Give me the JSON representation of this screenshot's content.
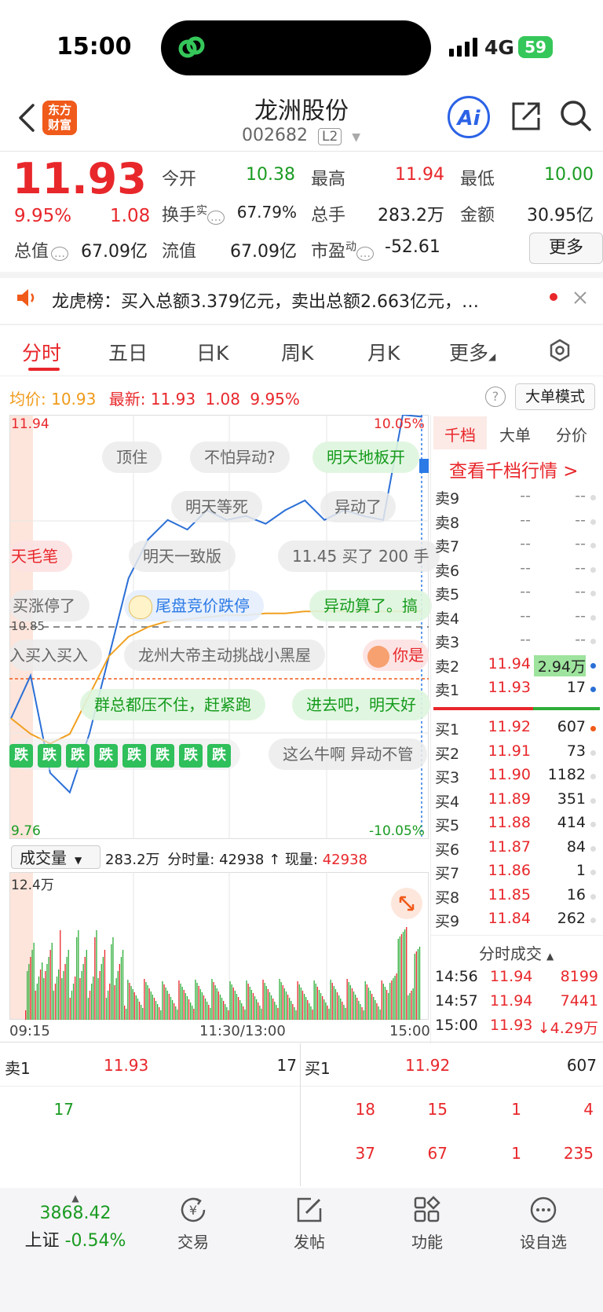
{
  "status": {
    "time": "15:00",
    "network": "4G",
    "battery": "59"
  },
  "header": {
    "logo_line1": "东方",
    "logo_line2": "财富",
    "name": "龙洲股份",
    "code": "002682",
    "level": "L2",
    "ai_label": "Ai"
  },
  "quote": {
    "price": "11.93",
    "pct": "9.95%",
    "change": "1.08",
    "open_label": "今开",
    "open": "10.38",
    "high_label": "最高",
    "high": "11.94",
    "low_label": "最低",
    "low": "10.00",
    "turnover_label": "换手",
    "turnover_sup": "实",
    "turnover": "67.79%",
    "volume_label": "总手",
    "volume": "283.2万",
    "amount_label": "金额",
    "amount": "30.95亿",
    "mcap_label": "总值",
    "mcap": "67.09亿",
    "float_label": "流值",
    "float": "67.09亿",
    "pe_label": "市盈",
    "pe_sup": "动",
    "pe": "-52.61",
    "more": "更多"
  },
  "notice": {
    "text": "龙虎榜：买入总额3.379亿元，卖出总额2.663亿元，…"
  },
  "tabs": [
    "分时",
    "五日",
    "日K",
    "周K",
    "月K",
    "更多"
  ],
  "avgbar": {
    "avg_label": "均价:",
    "avg": "10.93",
    "latest_label": "最新:",
    "latest": "11.93",
    "chg": "1.08",
    "pct": "9.95%",
    "mode": "大单模式"
  },
  "chart": {
    "y_max": "11.94",
    "y_min": "9.76",
    "pct_max": "10.05%",
    "pct_min": "-10.05%",
    "ref_price": "10.85",
    "bubbles": [
      "顶住",
      "不怕异动?",
      "明天地板开",
      "明天等死",
      "异动了",
      "天毛笔",
      "明天一致版",
      "11.45 买了 200 手",
      "买涨停了",
      "尾盘竞价跌停",
      "异动算了。搞",
      "入买入买入",
      "龙州大帝主动挑战小黑屋",
      "你是",
      "群总都压不住，赶紧跑",
      "进去吧，明天好",
      "这么牛啊 异动不管"
    ],
    "die_label": "跌",
    "vol_select": "成交量",
    "vol_info_total": "283.2万",
    "vol_info_min_label": "分时量:",
    "vol_info_min": "42938",
    "vol_info_now_label": "现量:",
    "vol_info_now": "42938",
    "vol_max": "12.4万",
    "time_start": "09:15",
    "time_mid": "11:30/13:00",
    "time_end": "15:00"
  },
  "chart_data": {
    "type": "line",
    "title": "",
    "ylim": [
      9.76,
      11.94
    ],
    "x_ticks": [
      "09:15",
      "11:30/13:00",
      "15:00"
    ],
    "series": [
      {
        "values": [
          10.38,
          10.6,
          10.1,
          10.0,
          10.3,
          10.7,
          11.1,
          11.3,
          11.4,
          11.35,
          11.45,
          11.4,
          11.42,
          11.38,
          11.45,
          11.5,
          11.4,
          11.45,
          11.42,
          11.4,
          11.94,
          11.93
        ]
      },
      {
        "values": [
          10.38,
          10.3,
          10.25,
          10.3,
          10.5,
          10.7,
          10.8,
          10.85,
          10.88,
          10.89,
          10.9,
          10.91,
          10.91,
          10.92,
          10.92,
          10.93,
          10.93,
          10.93,
          10.93,
          10.93,
          10.93,
          10.93
        ]
      }
    ]
  },
  "orderbook": {
    "tabs": [
      "千档",
      "大单",
      "分价"
    ],
    "link": "查看千档行情 >",
    "asks": [
      {
        "label": "卖9",
        "price": "--",
        "vol": "--"
      },
      {
        "label": "卖8",
        "price": "--",
        "vol": "--"
      },
      {
        "label": "卖7",
        "price": "--",
        "vol": "--"
      },
      {
        "label": "卖6",
        "price": "--",
        "vol": "--"
      },
      {
        "label": "卖5",
        "price": "--",
        "vol": "--"
      },
      {
        "label": "卖4",
        "price": "--",
        "vol": "--"
      },
      {
        "label": "卖3",
        "price": "--",
        "vol": "--"
      },
      {
        "label": "卖2",
        "price": "11.94",
        "vol": "2.94万"
      },
      {
        "label": "卖1",
        "price": "11.93",
        "vol": "17"
      }
    ],
    "bids": [
      {
        "label": "买1",
        "price": "11.92",
        "vol": "607"
      },
      {
        "label": "买2",
        "price": "11.91",
        "vol": "73"
      },
      {
        "label": "买3",
        "price": "11.90",
        "vol": "1182"
      },
      {
        "label": "买4",
        "price": "11.89",
        "vol": "351"
      },
      {
        "label": "买5",
        "price": "11.88",
        "vol": "414"
      },
      {
        "label": "买6",
        "price": "11.87",
        "vol": "84"
      },
      {
        "label": "买7",
        "price": "11.86",
        "vol": "1"
      },
      {
        "label": "买8",
        "price": "11.85",
        "vol": "16"
      },
      {
        "label": "买9",
        "price": "11.84",
        "vol": "262"
      }
    ],
    "trades_title": "分时成交",
    "trades": [
      {
        "time": "14:56",
        "price": "11.94",
        "vol": "8199"
      },
      {
        "time": "14:57",
        "price": "11.94",
        "vol": "7441"
      },
      {
        "time": "15:00",
        "price": "11.93",
        "vol": "↓4.29万"
      }
    ]
  },
  "queue": {
    "sell_label": "卖1",
    "sell_price": "11.93",
    "sell_vol": "17",
    "buy_label": "买1",
    "buy_price": "11.92",
    "buy_vol": "607",
    "sell_orders": [
      "17"
    ],
    "buy_orders_row1": [
      "18",
      "15",
      "1",
      "4"
    ],
    "buy_orders_row2": [
      "37",
      "67",
      "1",
      "235"
    ]
  },
  "nav": {
    "index_value": "3868.42",
    "index_name": "上证",
    "index_pct": "-0.54%",
    "trade": "交易",
    "post": "发帖",
    "func": "功能",
    "watch": "设自选"
  }
}
